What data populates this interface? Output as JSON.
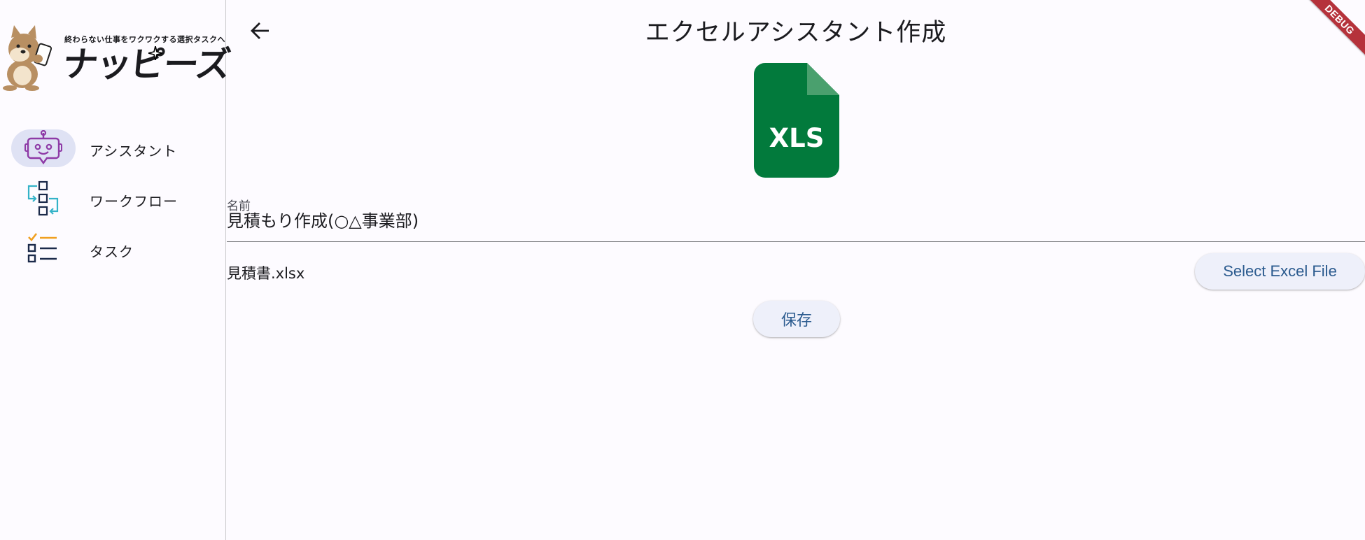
{
  "sidebar": {
    "logo": {
      "tagline": "終わらない仕事をワクワクする選択タスクへ",
      "brand": "ナッピーズ"
    },
    "items": [
      {
        "label": "アシスタント",
        "icon": "robot-icon",
        "active": true
      },
      {
        "label": "ワークフロー",
        "icon": "workflow-icon",
        "active": false
      },
      {
        "label": "タスク",
        "icon": "task-list-icon",
        "active": false
      }
    ]
  },
  "header": {
    "title": "エクセルアシスタント作成",
    "back_icon": "arrow-left-icon"
  },
  "file_icon": {
    "text": "XLS",
    "color": "#027a3c",
    "fold_color": "#4aa06e"
  },
  "form": {
    "name_label": "名前",
    "name_value": "見積もり作成(○△事業部)",
    "selected_file": "見積書.xlsx",
    "select_button_label": "Select Excel File",
    "save_button_label": "保存"
  },
  "debug_banner": "DEBUG",
  "colors": {
    "background": "#fdfbff",
    "active_nav": "#dfe2f4",
    "button_bg": "#eef0fa",
    "button_text": "#2a5a8e",
    "debug": "#b5323b"
  }
}
